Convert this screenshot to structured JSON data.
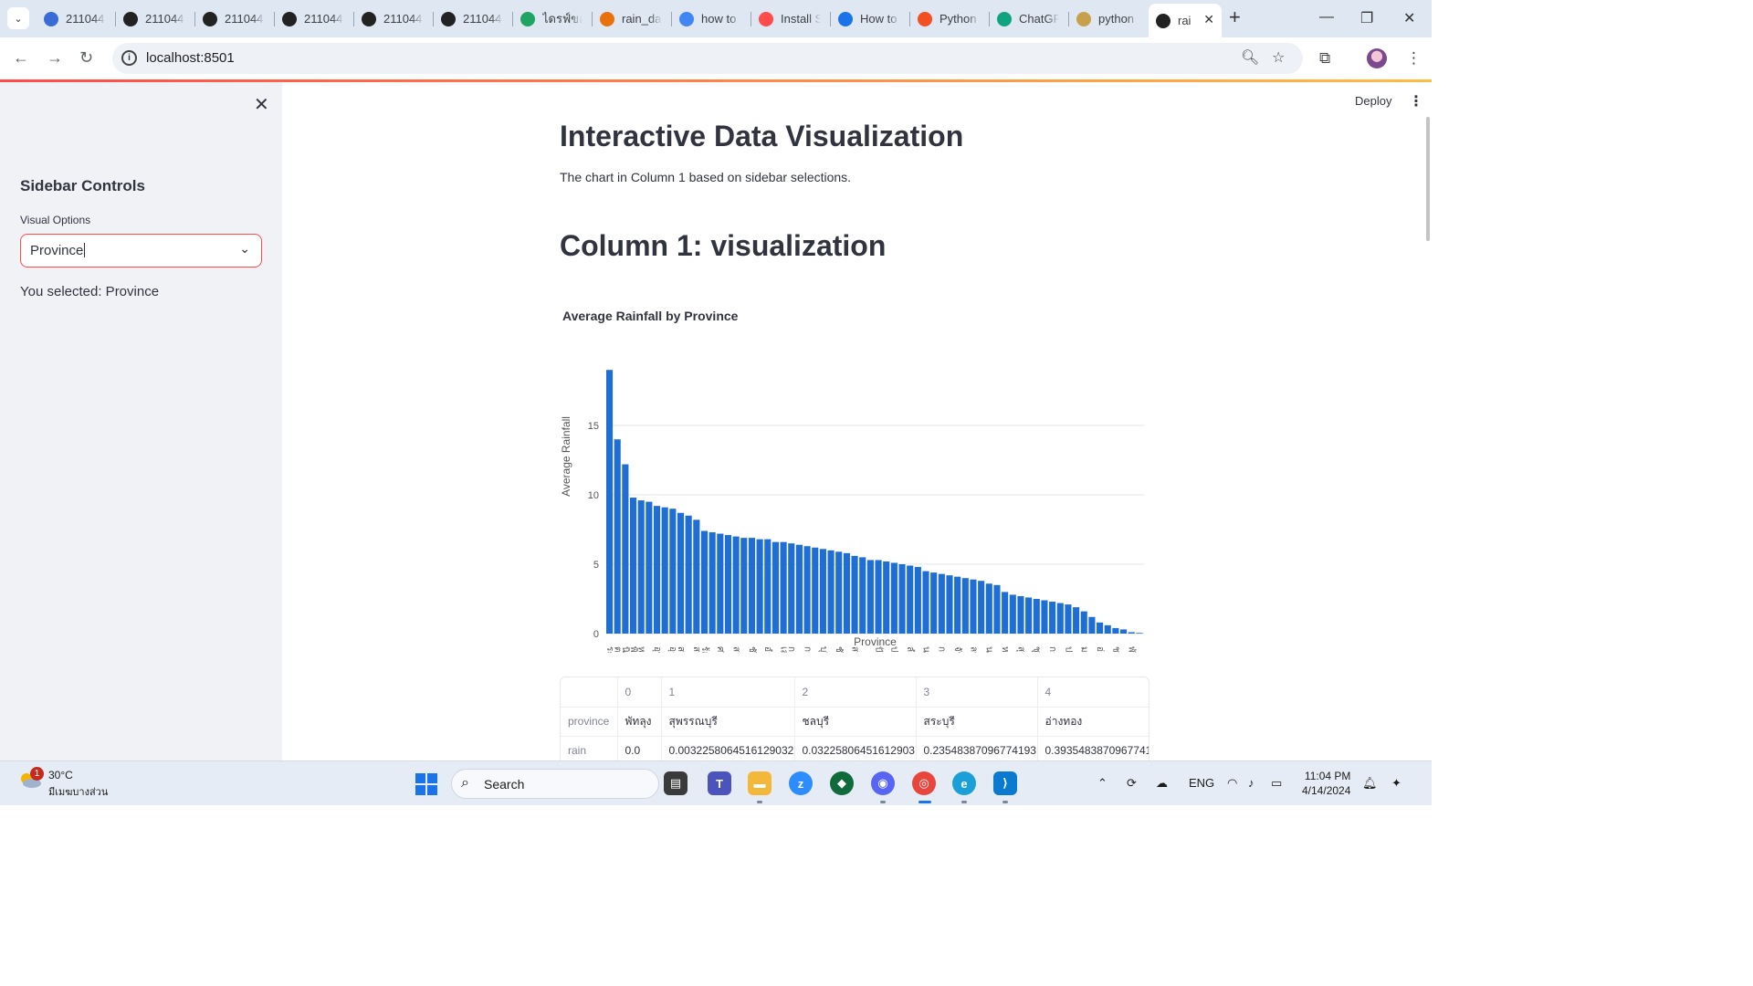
{
  "browser": {
    "tabs": [
      {
        "title": "211044",
        "icon": "ai-logo-icon",
        "color": "#3b6bd6"
      },
      {
        "title": "211044",
        "icon": "github-icon",
        "color": "#222222"
      },
      {
        "title": "211044",
        "icon": "github-icon",
        "color": "#222222"
      },
      {
        "title": "211044",
        "icon": "github-icon",
        "color": "#222222"
      },
      {
        "title": "211044",
        "icon": "github-icon",
        "color": "#222222"
      },
      {
        "title": "211044",
        "icon": "github-icon",
        "color": "#222222"
      },
      {
        "title": "ไดรฟ์ของ",
        "icon": "google-drive-icon",
        "color": "#1fa463"
      },
      {
        "title": "rain_da",
        "icon": "colab-icon",
        "color": "#e8710a"
      },
      {
        "title": "how to",
        "icon": "google-icon",
        "color": "#4285f4"
      },
      {
        "title": "Install S",
        "icon": "streamlit-icon",
        "color": "#ff4b4b"
      },
      {
        "title": "How to",
        "icon": "globe-icon",
        "color": "#1a73e8"
      },
      {
        "title": "Python",
        "icon": "microsoft-icon",
        "color": "#f25022"
      },
      {
        "title": "ChatGP",
        "icon": "chatgpt-icon",
        "color": "#10a37f"
      },
      {
        "title": "python",
        "icon": "mortar-icon",
        "color": "#c7a04b"
      },
      {
        "title": "rai",
        "icon": "streamlit-icon",
        "color": "#222222"
      }
    ],
    "address": "localhost:8501"
  },
  "sidebar": {
    "title": "Sidebar Controls",
    "select_label": "Visual Options",
    "selected_value": "Province",
    "note": "You selected: Province"
  },
  "header": {
    "deploy_label": "Deploy"
  },
  "main": {
    "title": "Interactive Data Visualization",
    "caption": "The chart in Column 1 based on sidebar selections.",
    "subheader": "Column 1: visualization"
  },
  "chart_data": {
    "type": "bar",
    "title": "Average Rainfall by Province",
    "xlabel": "Province",
    "ylabel": "Average Rainfall",
    "ylim": [
      0,
      20
    ],
    "yticks": [
      0,
      5,
      10,
      15
    ],
    "grid": true,
    "color": "#1f6ed4",
    "categories": [
      "ระนอง",
      "ตราด",
      "นิบาทร์",
      "พิษณุโลก",
      "หนองคาย",
      "อุบลราชธานี",
      "อุตรดิตถ์",
      "สกลนคร",
      "สมุทรสงคราม",
      "ร้อยเอ็ด",
      "ศรีสะเกษ",
      "สตูล",
      "ชัยภูมิ",
      "อำนาจเจริญ",
      "เลย",
      "กาฬสินธุ์",
      "กระบี่",
      "บุรีรัมย์",
      "ชัยนาท",
      "สมุทรสาคร",
      "ปัตตานี",
      "ปราจีนบุรี",
      "ลำพูน",
      "นครราชสีมา",
      "กาญจนบุรี",
      "จันทบุรี",
      "ลพบุรี",
      "นราธิวาส",
      "หนองบัวลำภู",
      "สุราษฎร์ธานี",
      "ชุมพร",
      "กรุงเทพมหานคร",
      "ประจวบคีรีขันธ์",
      "มหาสารคาม",
      "อ่างทอง",
      "ชลบุรี",
      "พัทลุง"
    ],
    "values": [
      19.0,
      14.0,
      12.2,
      9.8,
      9.6,
      9.2,
      9.0,
      8.7,
      8.2,
      7.4,
      7.2,
      7.0,
      6.9,
      6.8,
      6.6,
      6.5,
      6.3,
      6.1,
      5.9,
      5.6,
      5.3,
      5.1,
      4.9,
      4.5,
      4.3,
      4.1,
      3.9,
      3.6,
      3.0,
      2.7,
      2.5,
      2.3,
      2.1,
      1.6,
      0.8,
      0.4,
      0.1
    ],
    "extra_bars": [
      9.5,
      9.1,
      8.5,
      7.3,
      7.1,
      6.9,
      6.8,
      6.6,
      6.4,
      6.2,
      6.0,
      5.8,
      5.5,
      5.3,
      5.2,
      5.0,
      4.8,
      4.4,
      4.2,
      4.0,
      3.8,
      3.5,
      2.8,
      2.6,
      2.4,
      2.2,
      1.9,
      1.2,
      0.6,
      0.3,
      0.05
    ]
  },
  "dataframe": {
    "columns": [
      "0",
      "1",
      "2",
      "3",
      "4"
    ],
    "rows": [
      {
        "label": "province",
        "cells": [
          "พัทลุง",
          "สุพรรณบุรี",
          "ชลบุรี",
          "สระบุรี",
          "อ่างทอง"
        ]
      },
      {
        "label": "rain",
        "cells": [
          "0.0",
          "0.0032258064516129032",
          "0.03225806451612903",
          "0.23548387096774193",
          "0.3935483870967741"
        ]
      }
    ]
  },
  "taskbar": {
    "weather_temp": "30°C",
    "weather_desc": "มีเมฆบางส่วน",
    "weather_badge": "1",
    "search_label": "Search",
    "lang": "ENG",
    "time": "11:04 PM",
    "date": "4/14/2024"
  }
}
